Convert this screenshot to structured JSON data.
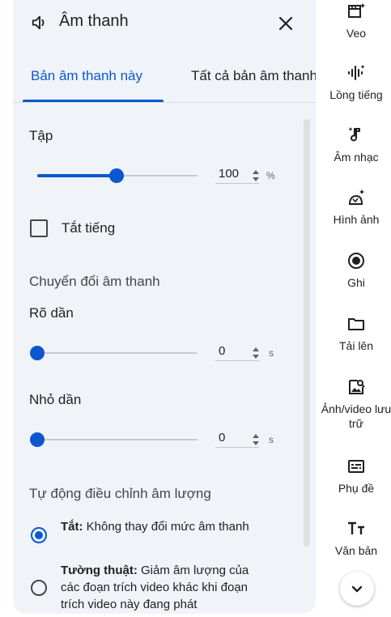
{
  "header": {
    "title": "Âm thanh",
    "title_icon": "volume-icon",
    "close_icon": "close-icon"
  },
  "tabs": [
    {
      "label": "Bản âm thanh này",
      "active": true
    },
    {
      "label": "Tất cả bản âm thanh",
      "active": false
    }
  ],
  "volume": {
    "label": "Tập",
    "value": "100",
    "unit": "%",
    "level": 0.5
  },
  "mute": {
    "label": "Tắt tiếng",
    "checked": false
  },
  "transition": {
    "section_label": "Chuyển đổi âm thanh",
    "fade_in": {
      "label": "Rõ dần",
      "value": "0",
      "unit": "s"
    },
    "fade_out": {
      "label": "Nhỏ dần",
      "value": "0",
      "unit": "s"
    }
  },
  "auto_volume": {
    "section_label": "Tự động điều chỉnh âm lượng",
    "options": [
      {
        "bold": "Tắt:",
        "text": " Không thay đổi mức âm thanh",
        "selected": true
      },
      {
        "bold": "Tường thuật:",
        "text": " Giảm âm lượng của các đoạn trích video khác khi đoạn trích video này đang phát",
        "selected": false
      }
    ]
  },
  "accent_color": "#0b57d0",
  "rail": {
    "items": [
      {
        "label": "Veo",
        "icon": "clapperboard-sparkle-icon"
      },
      {
        "label": "Lồng tiếng",
        "icon": "voice-waveform-icon"
      },
      {
        "label": "Âm nhạc",
        "icon": "music-note-icon"
      },
      {
        "label": "Hình ảnh",
        "icon": "image-sparkle-icon"
      },
      {
        "label": "Ghi",
        "icon": "record-icon"
      },
      {
        "label": "Tải lên",
        "icon": "folder-icon"
      },
      {
        "label": "Ảnh/video lưu trữ",
        "icon": "stock-media-icon"
      },
      {
        "label": "Phụ đề",
        "icon": "subtitles-icon"
      },
      {
        "label": "Văn bản",
        "icon": "text-icon"
      }
    ],
    "more_icon": "chevron-down-icon"
  }
}
